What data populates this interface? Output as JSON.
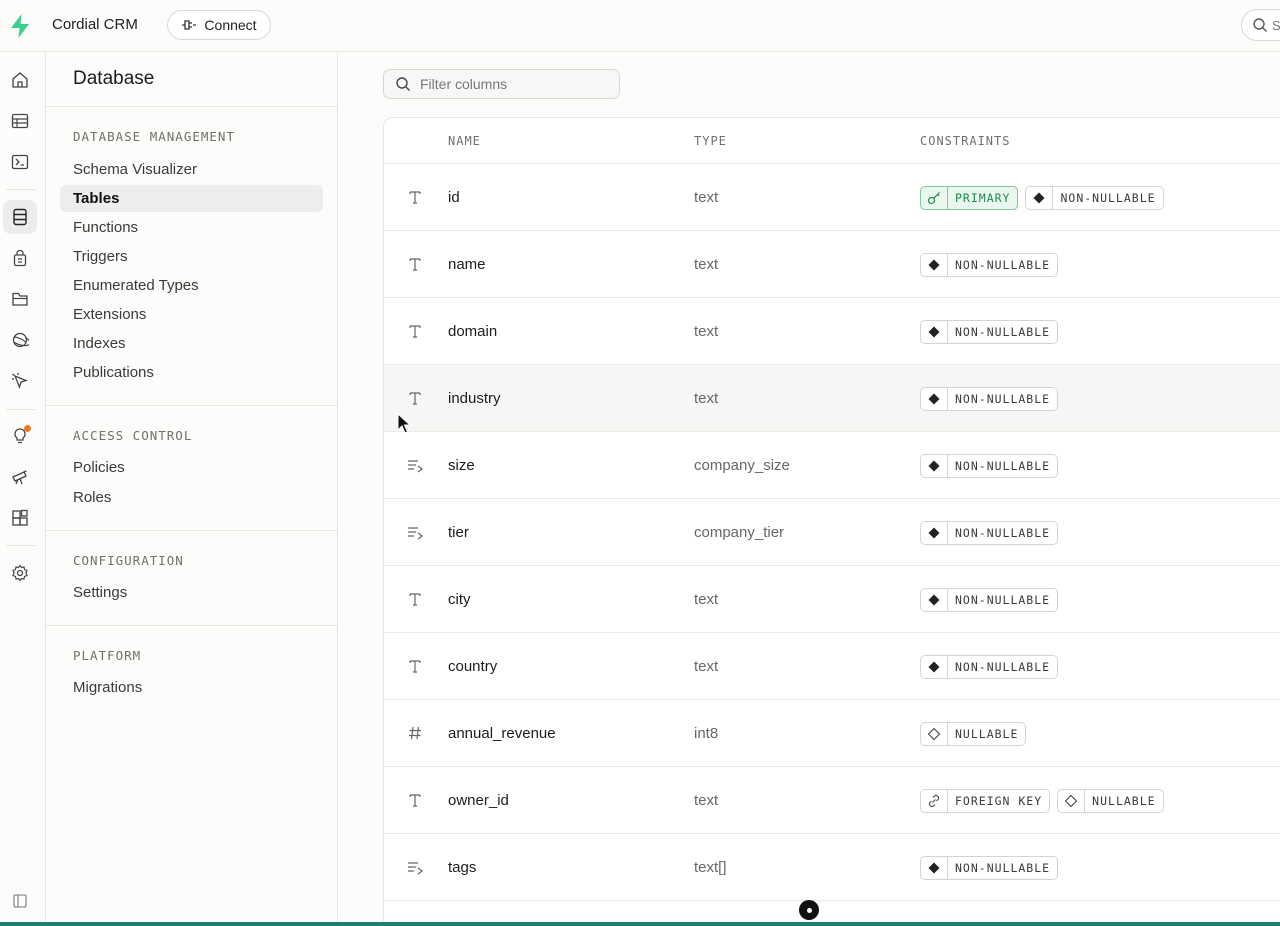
{
  "app": {
    "title": "Cordial CRM",
    "connect_label": "Connect",
    "search_placeholder": "S"
  },
  "rail": {
    "items": [
      {
        "icon": "home-icon"
      },
      {
        "icon": "table-editor-icon"
      },
      {
        "icon": "sql-editor-icon"
      },
      {
        "icon": "database-icon",
        "active": true
      },
      {
        "icon": "auth-icon"
      },
      {
        "icon": "storage-icon"
      },
      {
        "icon": "realtime-icon"
      },
      {
        "icon": "edge-functions-icon"
      },
      {
        "icon": "advisors-icon",
        "notification": true
      },
      {
        "icon": "observability-icon"
      },
      {
        "icon": "integrations-icon"
      },
      {
        "icon": "settings-icon"
      },
      {
        "icon": "collapse-sidebar-icon"
      }
    ]
  },
  "sidebar": {
    "title": "Database",
    "sections": [
      {
        "heading": "DATABASE MANAGEMENT",
        "items": [
          "Schema Visualizer",
          "Tables",
          "Functions",
          "Triggers",
          "Enumerated Types",
          "Extensions",
          "Indexes",
          "Publications"
        ]
      },
      {
        "heading": "ACCESS CONTROL",
        "items": [
          "Policies",
          "Roles"
        ]
      },
      {
        "heading": "CONFIGURATION",
        "items": [
          "Settings"
        ]
      },
      {
        "heading": "PLATFORM",
        "items": [
          "Migrations"
        ]
      }
    ],
    "active_item": "Tables"
  },
  "main": {
    "filter_placeholder": "Filter columns",
    "columns": [
      "NAME",
      "TYPE",
      "CONSTRAINTS"
    ],
    "rows": [
      {
        "icon": "text-type-icon",
        "name": "id",
        "type": "text",
        "constraints": [
          "PRIMARY",
          "NON-NULLABLE"
        ]
      },
      {
        "icon": "text-type-icon",
        "name": "name",
        "type": "text",
        "constraints": [
          "NON-NULLABLE"
        ]
      },
      {
        "icon": "text-type-icon",
        "name": "domain",
        "type": "text",
        "constraints": [
          "NON-NULLABLE"
        ]
      },
      {
        "icon": "text-type-icon",
        "name": "industry",
        "type": "text",
        "constraints": [
          "NON-NULLABLE"
        ]
      },
      {
        "icon": "enum-type-icon",
        "name": "size",
        "type": "company_size",
        "constraints": [
          "NON-NULLABLE"
        ]
      },
      {
        "icon": "enum-type-icon",
        "name": "tier",
        "type": "company_tier",
        "constraints": [
          "NON-NULLABLE"
        ]
      },
      {
        "icon": "text-type-icon",
        "name": "city",
        "type": "text",
        "constraints": [
          "NON-NULLABLE"
        ]
      },
      {
        "icon": "text-type-icon",
        "name": "country",
        "type": "text",
        "constraints": [
          "NON-NULLABLE"
        ]
      },
      {
        "icon": "number-type-icon",
        "name": "annual_revenue",
        "type": "int8",
        "constraints": [
          "NULLABLE"
        ]
      },
      {
        "icon": "text-type-icon",
        "name": "owner_id",
        "type": "text",
        "constraints": [
          "FOREIGN KEY",
          "NULLABLE"
        ]
      },
      {
        "icon": "enum-type-icon",
        "name": "tags",
        "type": "text[]",
        "constraints": [
          "NON-NULLABLE"
        ]
      }
    ]
  },
  "colors": {
    "brand": "#3ecf8e",
    "primary_badge_border": "#7fc79d",
    "primary_badge_text": "#1f8a4c",
    "notification": "#e87a2a"
  }
}
